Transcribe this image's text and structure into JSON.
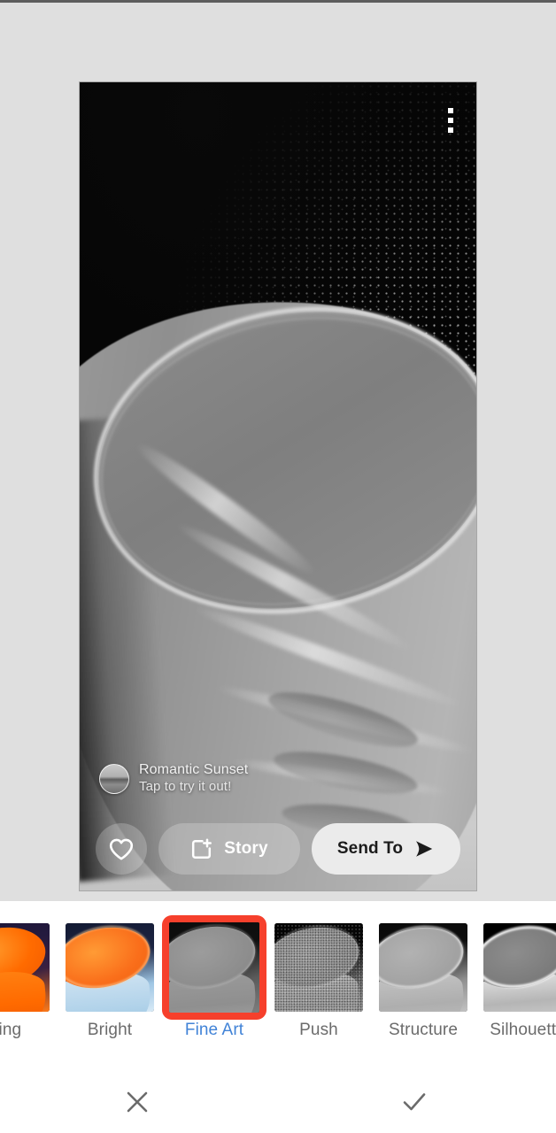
{
  "screen": {
    "name": "photo-filter-picker",
    "background_color": "#ffffff",
    "stage_background": "#dfdfdf"
  },
  "preview": {
    "name": "photo-preview",
    "media_kind": "black-and-white photo of a plastic cup on dark fabric",
    "menu": {
      "icon": "kebab-menu-icon",
      "label": "More options"
    },
    "lens": {
      "avatar_icon": "lens-avatar",
      "title": "Romantic Sunset",
      "subtitle": "Tap to try it out!"
    },
    "actions": {
      "heart": {
        "icon": "heart-icon",
        "label": ""
      },
      "story": {
        "icon": "add-to-story-icon",
        "label": "Story"
      },
      "send": {
        "icon": "send-arrow-icon",
        "label": "Send To"
      }
    }
  },
  "filters": {
    "name": "filter-carousel",
    "selected_index": 2,
    "selection_color": "#f6402c",
    "selected_label_color": "#4183d7",
    "label_color": "#6b6b6b",
    "items": [
      {
        "label": "ning",
        "style": "warm",
        "partial": true
      },
      {
        "label": "Bright",
        "style": "warm-blue",
        "partial": false
      },
      {
        "label": "Fine Art",
        "style": "mono-flat",
        "partial": false
      },
      {
        "label": "Push",
        "style": "mono-grain",
        "partial": false
      },
      {
        "label": "Structure",
        "style": "mono-soft",
        "partial": false
      },
      {
        "label": "Silhouette",
        "style": "mono-contrast",
        "partial": true
      }
    ]
  },
  "confirm_bar": {
    "name": "confirm-bar",
    "cancel": {
      "icon": "close-icon",
      "label": "Cancel"
    },
    "confirm": {
      "icon": "check-icon",
      "label": "Apply"
    }
  }
}
